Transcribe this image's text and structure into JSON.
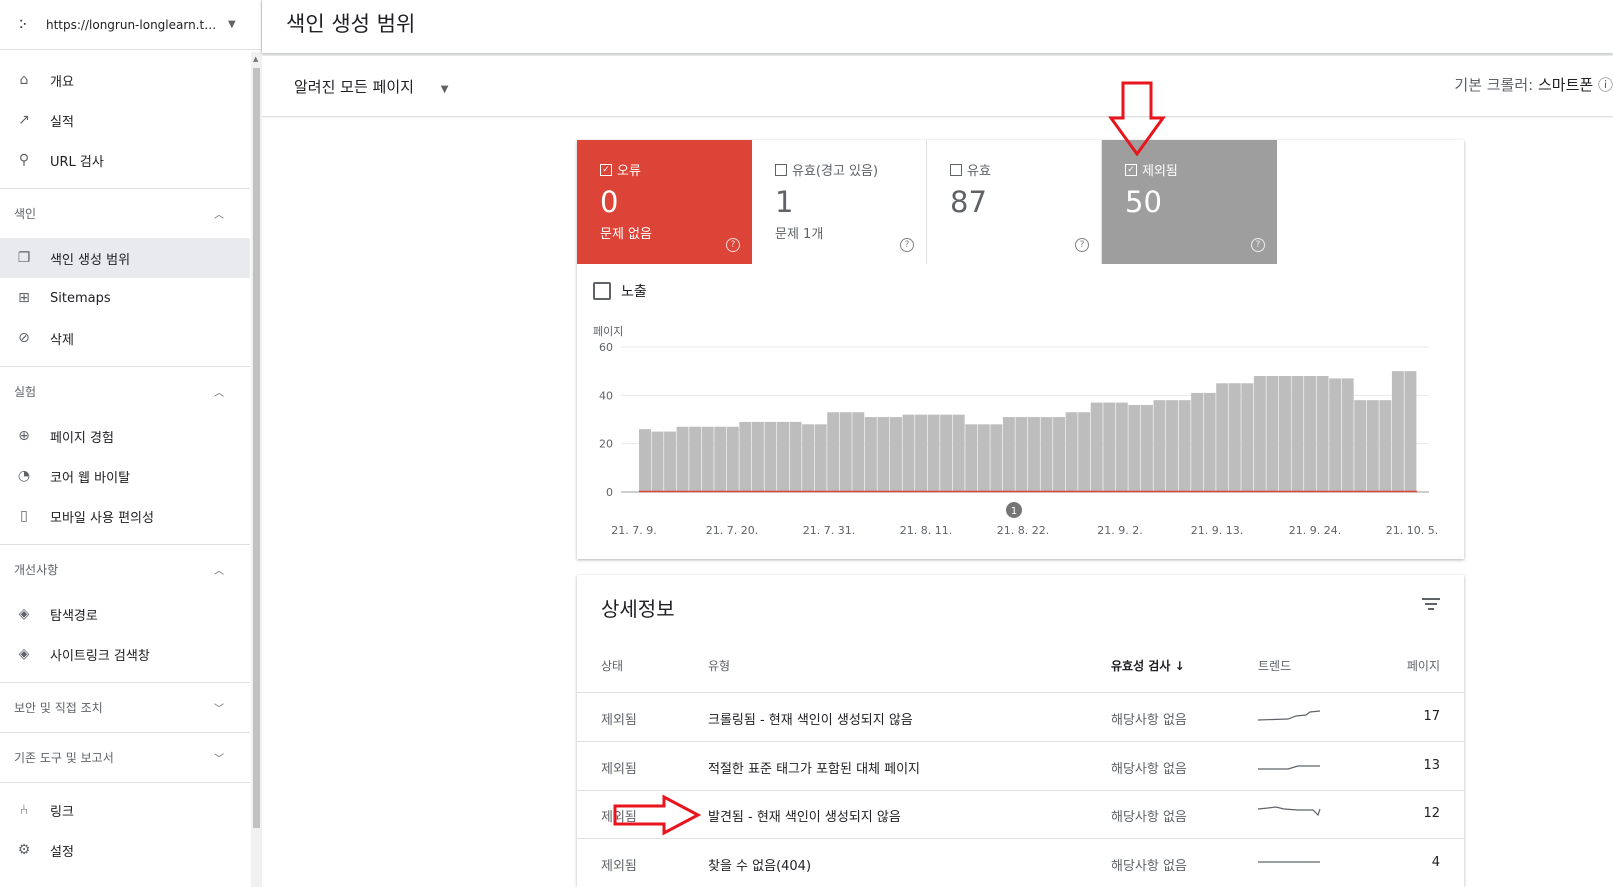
{
  "property": {
    "url": "https://longrun-longlearn.tistory.com/"
  },
  "sidebar": {
    "top_items": [
      {
        "label": "개요",
        "icon": "home-icon"
      },
      {
        "label": "실적",
        "icon": "trending-up-icon"
      },
      {
        "label": "URL 검사",
        "icon": "search-icon"
      }
    ],
    "sections": [
      {
        "title": "색인",
        "items": [
          {
            "label": "색인 생성 범위",
            "icon": "copy-icon"
          },
          {
            "label": "Sitemaps",
            "icon": "sitemap-icon"
          },
          {
            "label": "삭제",
            "icon": "eye-off-icon"
          }
        ]
      },
      {
        "title": "실험",
        "items": [
          {
            "label": "페이지 경험",
            "icon": "plus-circle-icon"
          },
          {
            "label": "코어 웹 바이탈",
            "icon": "speedometer-icon"
          },
          {
            "label": "모바일 사용 편의성",
            "icon": "phone-icon"
          }
        ]
      },
      {
        "title": "개선사항",
        "items": [
          {
            "label": "탐색경로",
            "icon": "layers-icon"
          },
          {
            "label": "사이트링크 검색창",
            "icon": "layers-icon"
          }
        ]
      },
      {
        "title": "보안 및 직접 조치"
      },
      {
        "title": "기존 도구 및 보고서"
      }
    ],
    "bottom_items": [
      {
        "label": "링크",
        "icon": "network-icon"
      },
      {
        "label": "설정",
        "icon": "gear-icon"
      }
    ]
  },
  "header": {
    "title": "색인 생성 범위"
  },
  "filter": {
    "label": "알려진 모든 페이지"
  },
  "crawler": {
    "label": "기본 크롤러:",
    "value": "스마트폰"
  },
  "tiles": [
    {
      "label": "오류",
      "value": "0",
      "sub": "문제 없음",
      "checked": true,
      "color": "#db4437"
    },
    {
      "label": "유효(경고 있음)",
      "value": "1",
      "sub": "문제 1개",
      "checked": false
    },
    {
      "label": "유효",
      "value": "87",
      "sub": "",
      "checked": false
    },
    {
      "label": "제외됨",
      "value": "50",
      "sub": "",
      "checked": true,
      "color": "#9e9e9e"
    }
  ],
  "impressions": {
    "label": "노출"
  },
  "chart_data": {
    "type": "bar",
    "ylabel": "페이지",
    "ylim": [
      0,
      60
    ],
    "yticks": [
      0,
      20,
      40,
      60
    ],
    "xticks": [
      "21. 7. 9.",
      "21. 7. 20.",
      "21. 7. 31.",
      "21. 8. 11.",
      "21. 8. 22.",
      "21. 9. 2.",
      "21. 9. 13.",
      "21. 9. 24.",
      "21. 10. 5."
    ],
    "annotation": "1",
    "series": [
      {
        "color": "#bdbdbd",
        "values": [
          26,
          25,
          25,
          27,
          27,
          27,
          27,
          27,
          29,
          29,
          29,
          29,
          29,
          28,
          28,
          33,
          33,
          33,
          31,
          31,
          31,
          32,
          32,
          32,
          32,
          32,
          28,
          28,
          28,
          31,
          31,
          31,
          31,
          31,
          33,
          33,
          37,
          37,
          37,
          36,
          36,
          38,
          38,
          38,
          41,
          41,
          45,
          45,
          45,
          48,
          48,
          48,
          48,
          48,
          48,
          47,
          47,
          38,
          38,
          38,
          50,
          50
        ]
      },
      {
        "color": "#db4437",
        "values": [
          0,
          0,
          0,
          0,
          0,
          0,
          0,
          0,
          0,
          0,
          0,
          0,
          0,
          0,
          0,
          0,
          0,
          0,
          0,
          0,
          0,
          0,
          0,
          0,
          0,
          0,
          0,
          0,
          0,
          0,
          0,
          0,
          0,
          0,
          0,
          0,
          0,
          0,
          0,
          0,
          0,
          0,
          0,
          0,
          0,
          0,
          0,
          0,
          0,
          0,
          0,
          0,
          0,
          0,
          0,
          0,
          0,
          0,
          0,
          0,
          0,
          0
        ]
      }
    ]
  },
  "details": {
    "title": "상세정보",
    "columns": [
      "상태",
      "유형",
      "유효성 검사",
      "트렌드",
      "페이지"
    ],
    "rows": [
      {
        "status": "제외됨",
        "type": "크롤링됨 - 현재 색인이 생성되지 않음",
        "validation": "해당사항 없음",
        "pages": "17"
      },
      {
        "status": "제외됨",
        "type": "적절한 표준 태그가 포함된 대체 페이지",
        "validation": "해당사항 없음",
        "pages": "13"
      },
      {
        "status": "제외됨",
        "type": "발견됨 - 현재 색인이 생성되지 않음",
        "validation": "해당사항 없음",
        "pages": "12"
      },
      {
        "status": "제외됨",
        "type": "찾을 수 없음(404)",
        "validation": "해당사항 없음",
        "pages": "4"
      }
    ]
  }
}
